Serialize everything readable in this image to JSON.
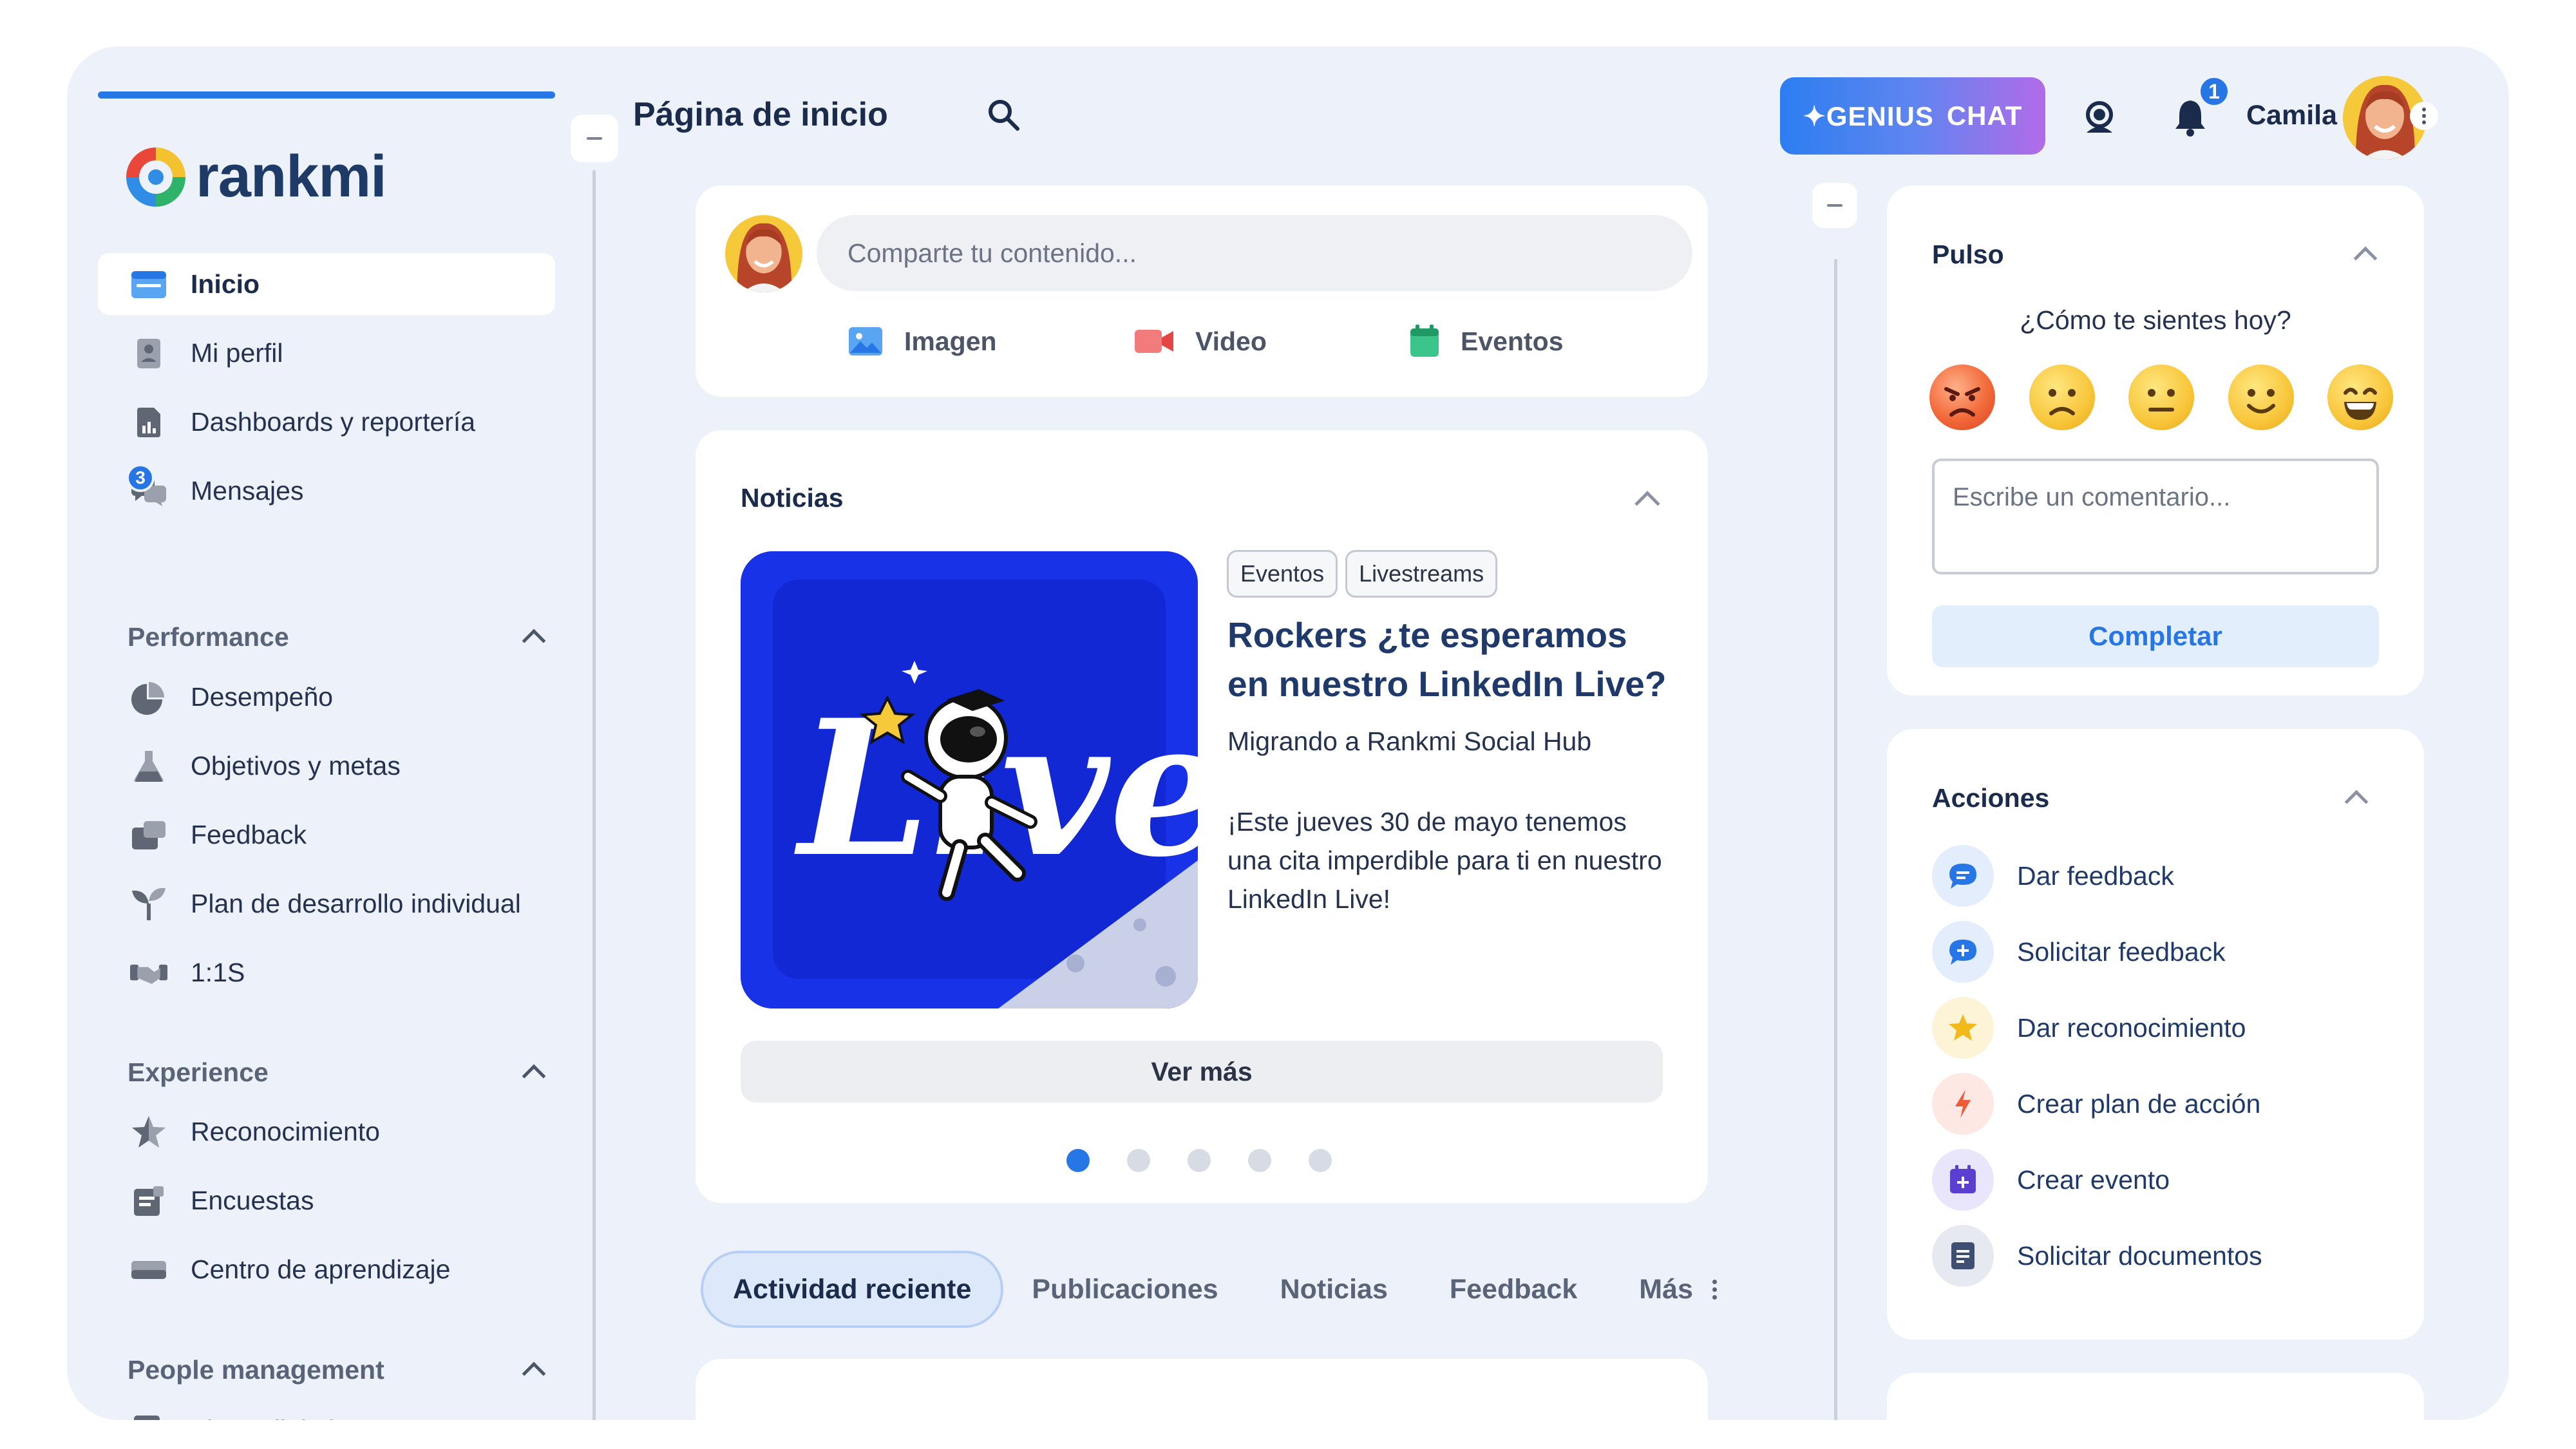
{
  "brand": {
    "name": "rankmi"
  },
  "header": {
    "page_title": "Página de inicio",
    "genius_label": "GENIUS",
    "chat_label": "CHAT",
    "notifications_count": "1",
    "user_name": "Camila"
  },
  "sidebar": {
    "main_items": [
      {
        "label": "Inicio",
        "icon": "home-icon"
      },
      {
        "label": "Mi perfil",
        "icon": "profile-icon"
      },
      {
        "label": "Dashboards y reportería",
        "icon": "report-icon"
      },
      {
        "label": "Mensajes",
        "icon": "chat-icon",
        "badge": "3"
      }
    ],
    "sections": [
      {
        "title": "Performance",
        "items": [
          {
            "label": "Desempeño",
            "icon": "pie-icon"
          },
          {
            "label": "Objetivos y metas",
            "icon": "flask-icon"
          },
          {
            "label": "Feedback",
            "icon": "feedback-icon"
          },
          {
            "label": "Plan de desarrollo individual",
            "icon": "sprout-icon"
          },
          {
            "label": "1:1S",
            "icon": "handshake-icon"
          }
        ]
      },
      {
        "title": "Experience",
        "items": [
          {
            "label": "Reconocimiento",
            "icon": "star-icon"
          },
          {
            "label": "Encuestas",
            "icon": "survey-icon"
          },
          {
            "label": "Centro de aprendizaje",
            "icon": "learning-icon"
          }
        ]
      },
      {
        "title": "People management",
        "items": [
          {
            "label": "Firma digital",
            "icon": "signature-icon"
          }
        ]
      }
    ]
  },
  "composer": {
    "placeholder": "Comparte tu contenido...",
    "options": [
      "Imagen",
      "Video",
      "Eventos"
    ]
  },
  "news": {
    "title": "Noticias",
    "tags": [
      "Eventos",
      "Livestreams"
    ],
    "headline": "Rockers ¿te esperamos en nuestro LinkedIn Live?",
    "subtitle": "Migrando a Rankmi Social Hub",
    "body": "¡Este jueves 30 de mayo tenemos una cita imperdible para ti en nuestro LinkedIn Live!",
    "image_word": "Live",
    "more_label": "Ver más",
    "carousel_total": 5,
    "carousel_active": 1
  },
  "tabs": [
    "Actividad reciente",
    "Publicaciones",
    "Noticias",
    "Feedback",
    "Más"
  ],
  "pulso": {
    "title": "Pulso",
    "question": "¿Cómo te sientes hoy?",
    "moods": [
      "angry",
      "sad",
      "neutral",
      "smile",
      "grin"
    ],
    "comment_placeholder": "Escribe un comentario...",
    "submit_label": "Completar"
  },
  "acciones": {
    "title": "Acciones",
    "items": [
      {
        "label": "Dar feedback",
        "icon": "chat-bubble-icon",
        "color": "#2776e6",
        "bg": "#e3edfb"
      },
      {
        "label": "Solicitar feedback",
        "icon": "chat-plus-icon",
        "color": "#2776e6",
        "bg": "#e3edfb"
      },
      {
        "label": "Dar reconocimiento",
        "icon": "star-icon",
        "color": "#f2b91b",
        "bg": "#fdf4d8"
      },
      {
        "label": "Crear plan de acción",
        "icon": "bolt-icon",
        "color": "#ee5a3a",
        "bg": "#fde8e3"
      },
      {
        "label": "Crear evento",
        "icon": "calendar-plus-icon",
        "color": "#5b3fd1",
        "bg": "#e9e5fb"
      },
      {
        "label": "Solicitar documentos",
        "icon": "document-icon",
        "color": "#3e4f73",
        "bg": "#e6e9ef"
      }
    ]
  },
  "colors": {
    "accent": "#2776e6",
    "background": "#edf1f9",
    "card": "#ffffff",
    "text_dark": "#1b2b4b"
  }
}
